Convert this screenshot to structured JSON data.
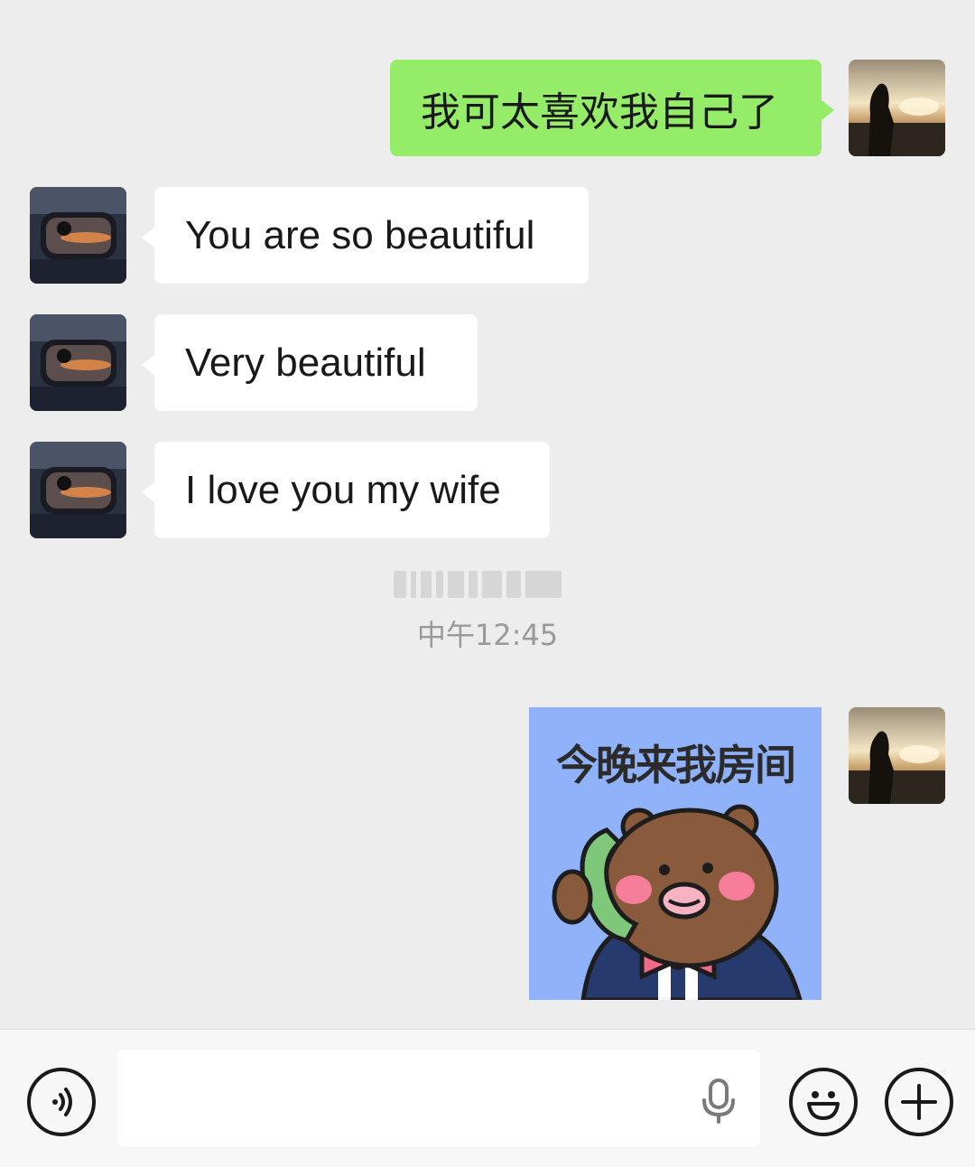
{
  "messages": [
    {
      "side": "right",
      "type": "text",
      "text": "我可太喜欢我自己了"
    },
    {
      "side": "left",
      "type": "text",
      "text": "You are so beautiful"
    },
    {
      "side": "left",
      "type": "text",
      "text": "Very beautiful"
    },
    {
      "side": "left",
      "type": "text",
      "text": "I love you my wife"
    },
    {
      "side": "right",
      "type": "sticker",
      "sticker_text": "今晚来我房间"
    }
  ],
  "timestamp": "中午12:45",
  "colors": {
    "sent_bubble": "#95ec69",
    "received_bubble": "#ffffff",
    "background": "#ededed"
  },
  "input_bar": {
    "voice_icon": "voice-toggle-icon",
    "mic_icon": "microphone-icon",
    "emoji_icon": "emoji-icon",
    "plus_icon": "plus-icon"
  }
}
